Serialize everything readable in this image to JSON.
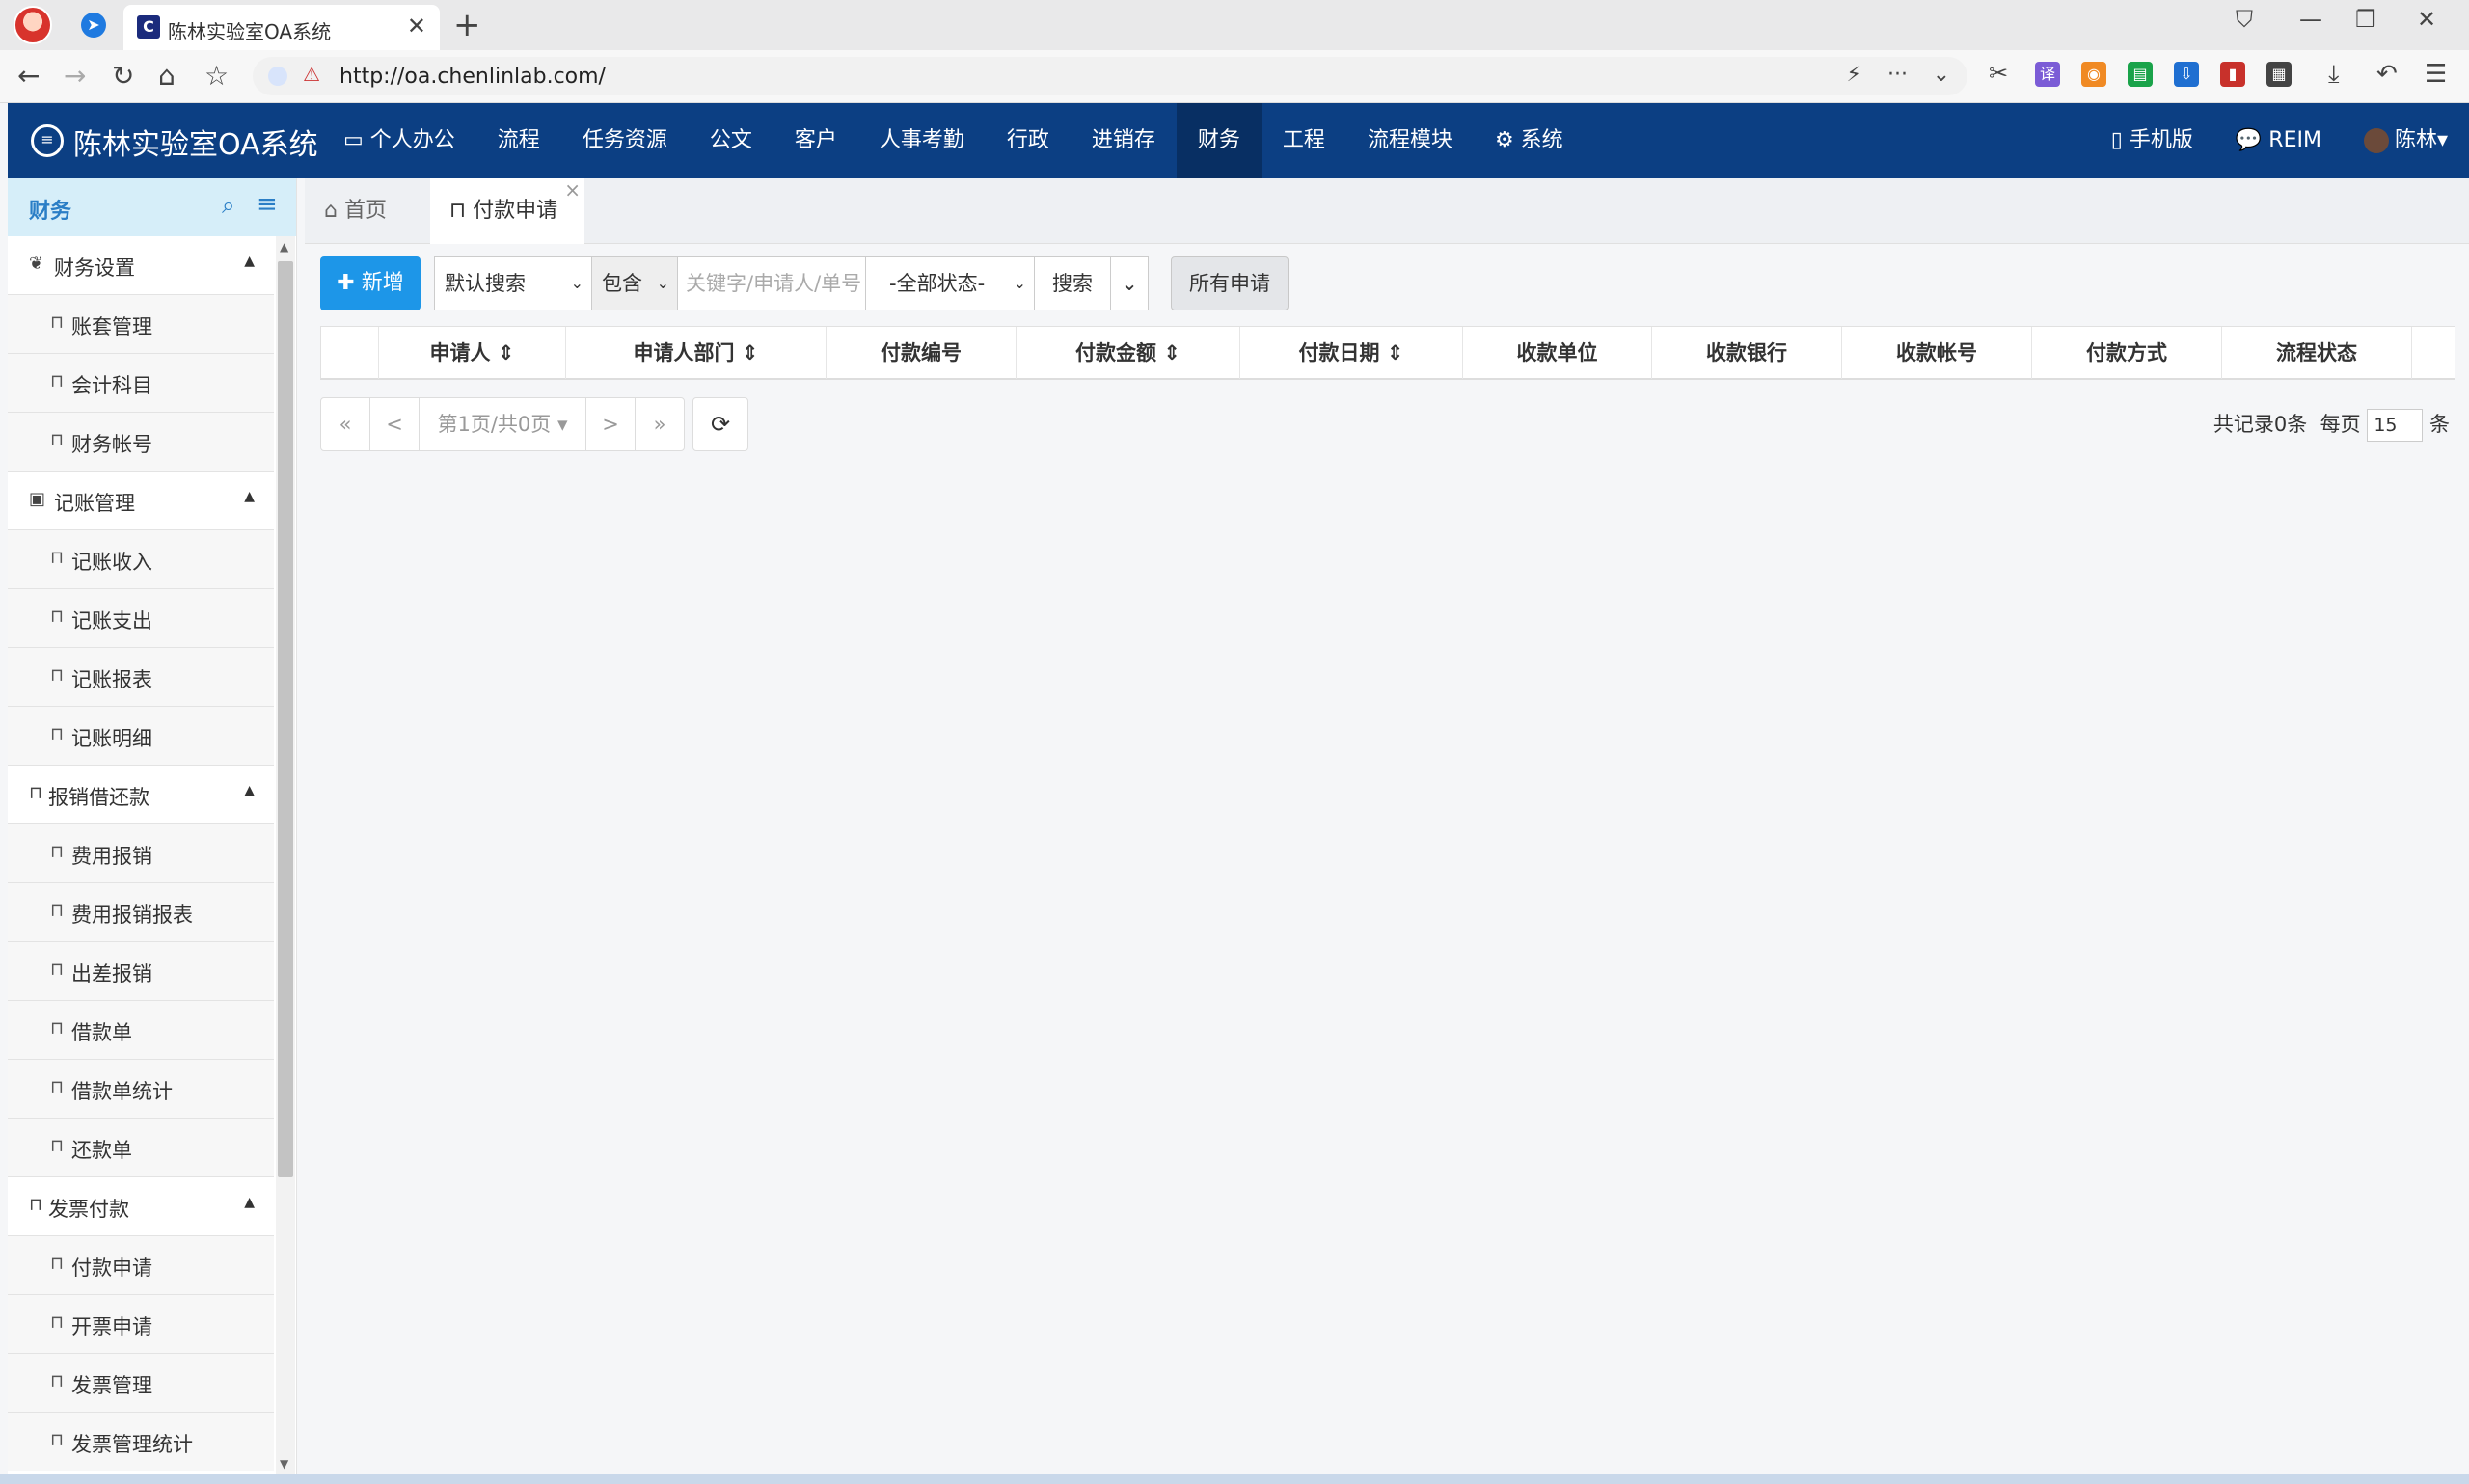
{
  "browser": {
    "tab_title": "陈林实验室OA系统",
    "url": "http://oa.chenlinlab.com/"
  },
  "app": {
    "brand": "陈林实验室OA系统",
    "nav": [
      "个人办公",
      "流程",
      "任务资源",
      "公文",
      "客户",
      "人事考勤",
      "行政",
      "进销存",
      "财务",
      "工程",
      "流程模块",
      "系统"
    ],
    "nav_active": "财务",
    "nav_right": {
      "mobile": "手机版",
      "reim": "REIM",
      "user": "陈林"
    }
  },
  "sidebar": {
    "title": "财务",
    "groups": [
      {
        "label": "财务设置",
        "items": [
          "账套管理",
          "会计科目",
          "财务帐号"
        ]
      },
      {
        "label": "记账管理",
        "items": [
          "记账收入",
          "记账支出",
          "记账报表",
          "记账明细"
        ]
      },
      {
        "label": "报销借还款",
        "items": [
          "费用报销",
          "费用报销报表",
          "出差报销",
          "借款单",
          "借款单统计",
          "还款单"
        ]
      },
      {
        "label": "发票付款",
        "items": [
          "付款申请",
          "开票申请",
          "发票管理",
          "发票管理统计"
        ]
      }
    ]
  },
  "page_tabs": {
    "home": "首页",
    "current": "付款申请"
  },
  "toolbar": {
    "add_label": "新增",
    "search_mode": "默认搜索",
    "match_mode": "包含",
    "keyword_placeholder": "关键字/申请人/单号",
    "status": "-全部状态-",
    "search_label": "搜索",
    "all_label": "所有申请"
  },
  "table": {
    "columns": [
      "",
      "申请人",
      "申请人部门",
      "付款编号",
      "付款金额",
      "付款日期",
      "收款单位",
      "收款银行",
      "收款帐号",
      "付款方式",
      "流程状态",
      ""
    ],
    "sortable": [
      false,
      true,
      true,
      false,
      true,
      true,
      false,
      false,
      false,
      false,
      false,
      false
    ],
    "rows": []
  },
  "pager": {
    "first": "«",
    "prev": "<",
    "page_info": "第1页/共0页",
    "next": ">",
    "last": "»",
    "total_text": "共记录0条",
    "per_page_label": "每页",
    "per_page": "15",
    "unit": "条"
  }
}
